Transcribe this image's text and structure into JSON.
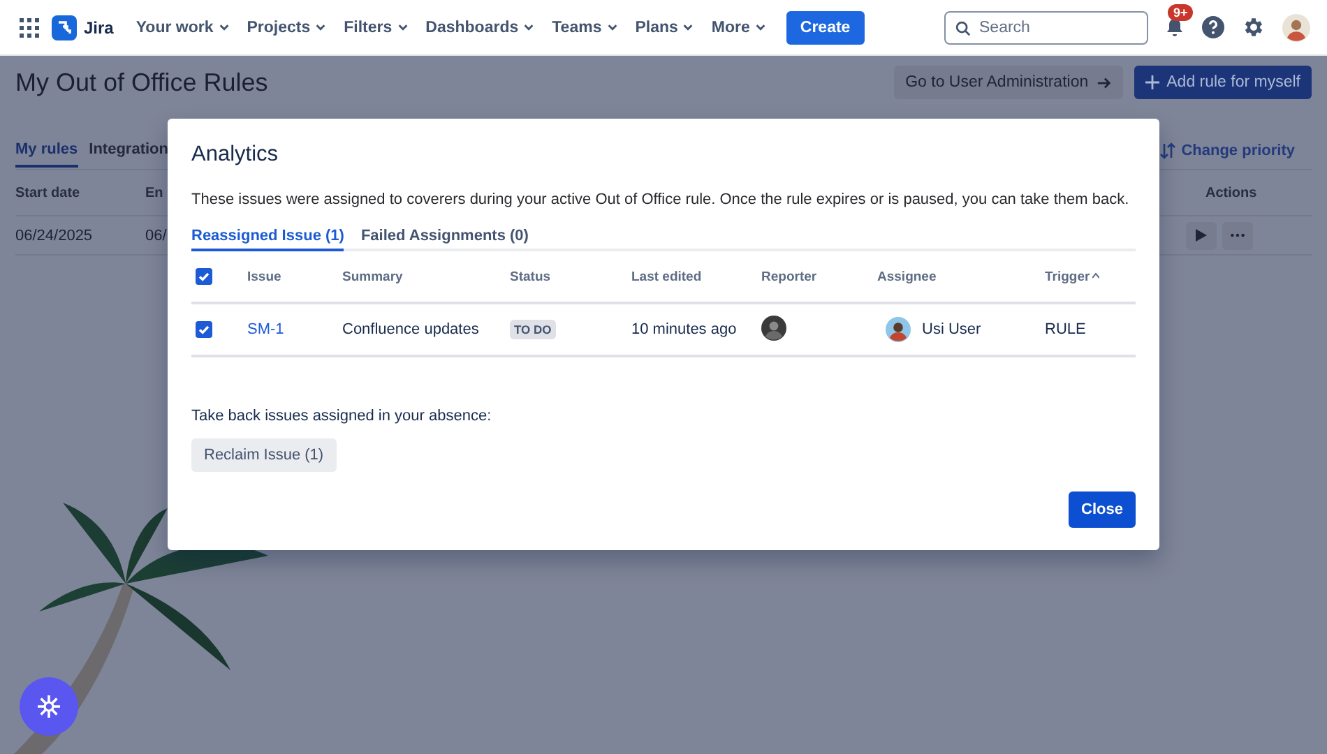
{
  "nav": {
    "product": "Jira",
    "items": [
      {
        "label": "Your work"
      },
      {
        "label": "Projects"
      },
      {
        "label": "Filters"
      },
      {
        "label": "Dashboards"
      },
      {
        "label": "Teams"
      },
      {
        "label": "Plans"
      },
      {
        "label": "More"
      }
    ],
    "create": "Create",
    "search": {
      "placeholder": "Search"
    },
    "notifications_badge": "9+"
  },
  "page": {
    "title": "My Out of Office Rules",
    "admin_button": "Go to User Administration",
    "add_button": "Add rule for myself",
    "tabs": [
      {
        "label": "My rules",
        "selected": true
      },
      {
        "label": "Integration",
        "selected": false
      }
    ],
    "change_priority": "Change priority",
    "table": {
      "columns": [
        "Start date",
        "En",
        "Actions"
      ],
      "rows": [
        {
          "start_date": "06/24/2025",
          "end": "06/"
        }
      ]
    }
  },
  "modal": {
    "title": "Analytics",
    "description": "These issues were assigned to coverers during your active Out of Office rule. Once the rule expires or is paused, you can take them back.",
    "tabs": [
      {
        "label": "Reassigned Issue (1)",
        "selected": true
      },
      {
        "label": "Failed Assignments (0)",
        "selected": false
      }
    ],
    "table": {
      "all_checked": true,
      "columns": [
        "Issue",
        "Summary",
        "Status",
        "Last edited",
        "Reporter",
        "Assignee",
        "Trigger"
      ],
      "rows": [
        {
          "checked": true,
          "issue": "SM-1",
          "summary": "Confluence updates",
          "status": "TO DO",
          "last_edited": "10 minutes ago",
          "assignee": "Usi User",
          "trigger": "RULE"
        }
      ]
    },
    "reclaim_label": "Take back issues assigned in your absence:",
    "reclaim_button": "Reclaim Issue (1)",
    "close_button": "Close"
  }
}
